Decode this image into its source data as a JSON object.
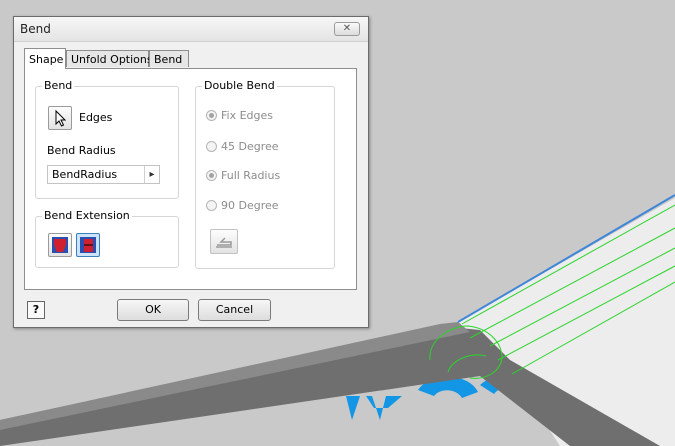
{
  "dialog": {
    "title": "Bend",
    "close_glyph": "✕",
    "tabs": [
      {
        "label": "Shape",
        "active": true
      },
      {
        "label": "Unfold Options",
        "active": false
      },
      {
        "label": "Bend",
        "active": false
      }
    ],
    "bend_group": {
      "label": "Bend",
      "edges_label": "Edges",
      "edges_icon": "cursor-select-icon",
      "radius_label": "Bend Radius",
      "radius_value": "BendRadius",
      "radius_arrow": "▸"
    },
    "extension_group": {
      "label": "Bend Extension",
      "icons": [
        "bend-extension-aligned-icon",
        "bend-extension-perpendicular-icon"
      ]
    },
    "double_bend_group": {
      "label": "Double Bend",
      "options": [
        {
          "label": "Fix Edges",
          "checked": true
        },
        {
          "label": "45 Degree",
          "checked": false
        },
        {
          "label": "Full Radius",
          "checked": true
        },
        {
          "label": "90 Degree",
          "checked": false
        }
      ],
      "flip_icon": "flip-fixed-edge-icon",
      "enabled": false
    },
    "help_glyph": "?",
    "ok_label": "OK",
    "cancel_label": "Cancel"
  },
  "colors": {
    "viewport_bg": "#c9c9c9",
    "sheet_surface": "#ededed",
    "sheet_edge": "#3d86d8",
    "bend_band": "#6f6f6f",
    "preview_lines": "#2bd42b",
    "text_decal": "#1396e6",
    "extension_icon_red": "#d02030",
    "extension_icon_blue": "#2a4fb0"
  }
}
